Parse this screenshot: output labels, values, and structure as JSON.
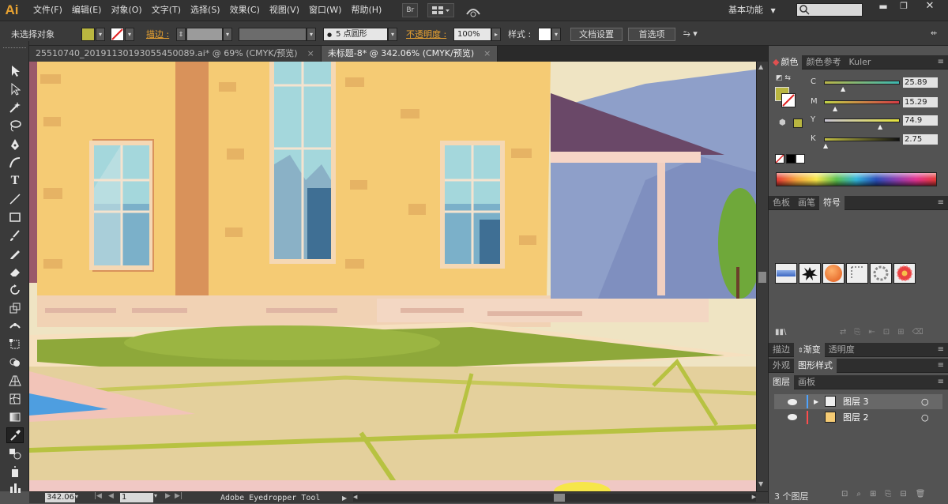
{
  "app": {
    "logo": "Ai",
    "workspace": "基本功能",
    "search_placeholder": ""
  },
  "menu": [
    "文件(F)",
    "编辑(E)",
    "对象(O)",
    "文字(T)",
    "选择(S)",
    "效果(C)",
    "视图(V)",
    "窗口(W)",
    "帮助(H)"
  ],
  "menu_buttons": {
    "bridge": "Br"
  },
  "control": {
    "selection": "未选择对象",
    "fill_color": "#b9b640",
    "stroke_label": "描边 :",
    "brush": "5 点圆形",
    "opacity_label": "不透明度 :",
    "opacity_value": "100%",
    "style_label": "样式 :",
    "doc_setup": "文档设置",
    "prefs": "首选项"
  },
  "tabs": [
    {
      "label": "25510740_20191130193055450089.ai* @ 69% (CMYK/预览)",
      "active": false,
      "close": "×"
    },
    {
      "label": "未标题-8* @ 342.06% (CMYK/预览)",
      "active": true,
      "close": "×"
    }
  ],
  "status": {
    "zoom": "342.06",
    "page": "1",
    "tool": "Adobe Eyedropper Tool"
  },
  "color_panel": {
    "tabs": [
      "颜色",
      "颜色参考",
      "Kuler"
    ],
    "sliders": [
      {
        "label": "C",
        "value": "25.89",
        "pct": 0.26
      },
      {
        "label": "M",
        "value": "15.29",
        "pct": 0.15
      },
      {
        "label": "Y",
        "value": "74.9",
        "pct": 0.75
      },
      {
        "label": "K",
        "value": "2.75",
        "pct": 0.03
      }
    ]
  },
  "swatch_panel": {
    "tabs": [
      "色板",
      "画笔",
      "符号"
    ]
  },
  "stroke_panel": {
    "tabs": [
      "描边",
      "渐变",
      "透明度"
    ]
  },
  "appearance_panel": {
    "tabs": [
      "外观",
      "图形样式"
    ]
  },
  "layers_panel": {
    "tabs": [
      "图层",
      "画板"
    ],
    "layers": [
      {
        "name": "图层 3",
        "color": "#4da3ff"
      },
      {
        "name": "图层 2",
        "color": "#ff4d4d"
      }
    ],
    "footer": "3 个图层"
  }
}
